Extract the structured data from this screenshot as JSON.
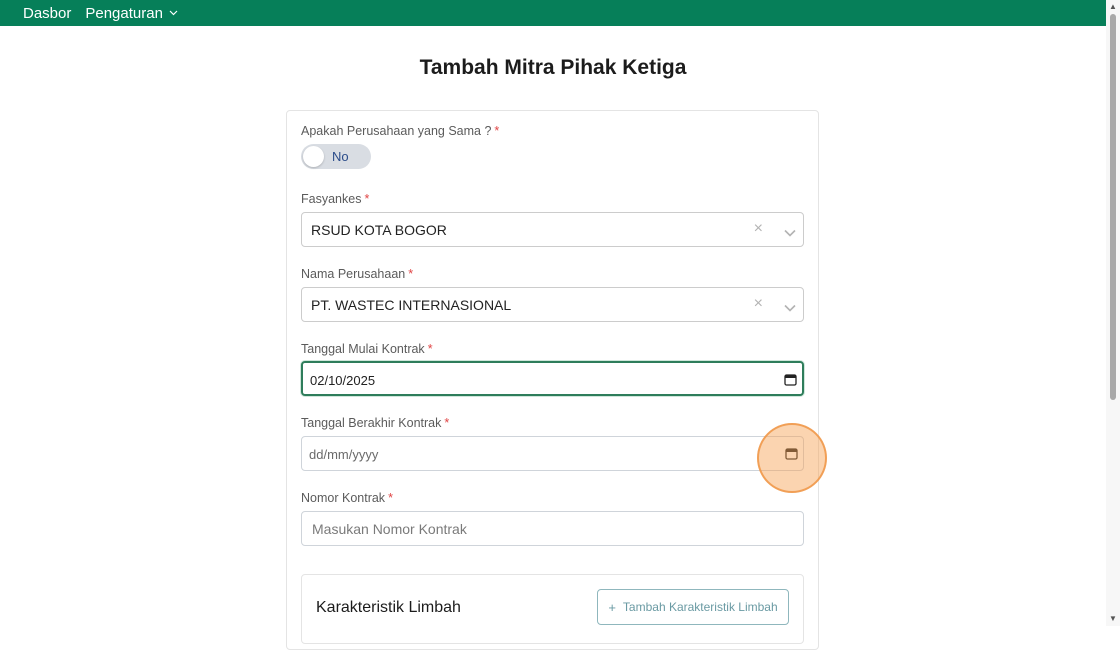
{
  "navbar": {
    "items": [
      {
        "label": "Dasbor"
      },
      {
        "label": "Pengaturan"
      }
    ],
    "color": "#067f59"
  },
  "page": {
    "title": "Tambah Mitra Pihak Ketiga"
  },
  "form": {
    "same_company": {
      "label": "Apakah Perusahaan yang Sama ?",
      "required_mark": "*",
      "toggle_text": "No"
    },
    "fasyankes": {
      "label": "Fasyankes",
      "required_mark": "*",
      "value": "RSUD KOTA BOGOR"
    },
    "company_name": {
      "label": "Nama Perusahaan",
      "required_mark": "*",
      "value": "PT. WASTEC INTERNASIONAL"
    },
    "start_date": {
      "label": "Tanggal Mulai Kontrak",
      "required_mark": "*",
      "value": "02/10/2025"
    },
    "end_date": {
      "label": "Tanggal Berakhir Kontrak",
      "required_mark": "*",
      "placeholder": "dd/mm/yyyy"
    },
    "contract_number": {
      "label": "Nomor Kontrak",
      "required_mark": "*",
      "placeholder": "Masukan Nomor Kontrak"
    },
    "waste_characteristics": {
      "title": "Karakteristik Limbah",
      "add_button_icon": "+",
      "add_button_label": "Tambah Karakteristik Limbah"
    }
  },
  "icons": {
    "clear": "×",
    "chevron": "chevron-down-icon",
    "calendar": "calendar-icon"
  }
}
